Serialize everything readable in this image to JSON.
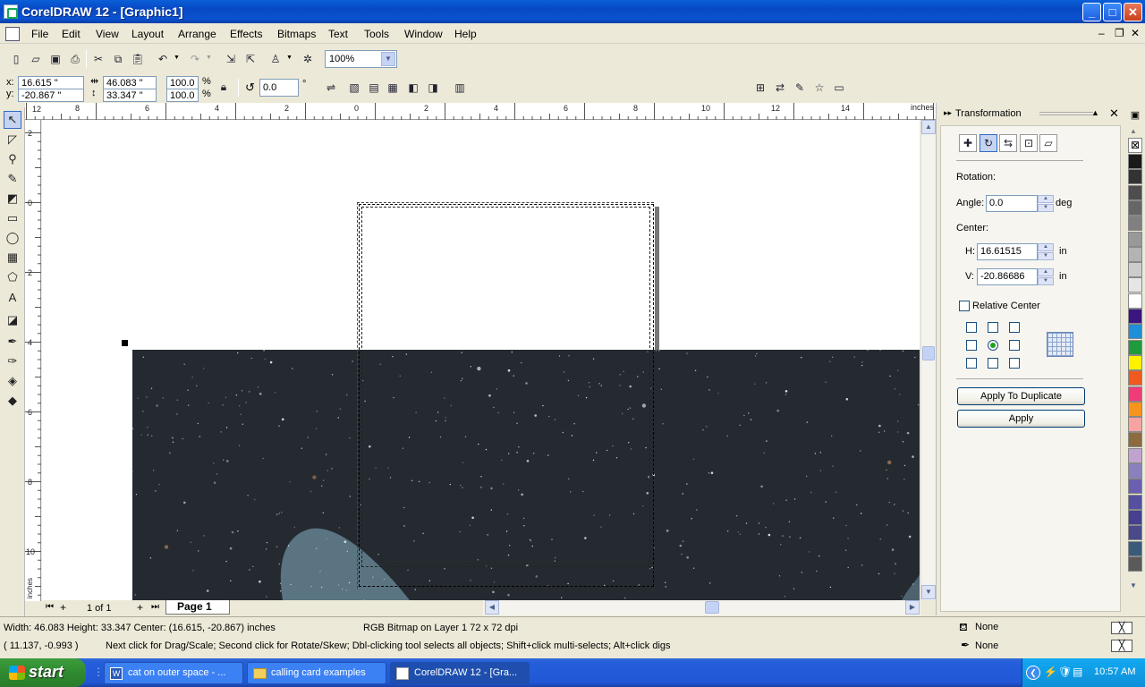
{
  "window": {
    "title": "CorelDRAW 12 - [Graphic1]"
  },
  "menu": [
    "File",
    "Edit",
    "View",
    "Layout",
    "Arrange",
    "Effects",
    "Bitmaps",
    "Text",
    "Tools",
    "Window",
    "Help"
  ],
  "toolbar": {
    "zoom": "100%"
  },
  "property_bar": {
    "x": "16.615 \"",
    "y": "-20.867 \"",
    "w": "46.083 \"",
    "h": "33.347 \"",
    "scale_x": "100.0",
    "scale_y": "100.0",
    "pct": "%",
    "rotation": "0.0",
    "deg": "°"
  },
  "ruler": {
    "h_labels": [
      "8",
      "6",
      "4",
      "2",
      "0",
      "2",
      "4",
      "6",
      "8",
      "10",
      "12",
      "14"
    ],
    "v_labels": [
      "2",
      "0",
      "2",
      "4",
      "6",
      "8",
      "10"
    ],
    "unit": "inches"
  },
  "page_nav": {
    "count": "1 of 1",
    "tab": "Page 1"
  },
  "docker": {
    "title": "Transformation",
    "rotation_label": "Rotation:",
    "angle_label": "Angle:",
    "angle_value": "0.0",
    "angle_unit": "deg",
    "center_label": "Center:",
    "h_label": "H:",
    "h_value": "16.61515",
    "h_unit": "in",
    "v_label": "V:",
    "v_value": "-20.86686",
    "v_unit": "in",
    "relative_center": "Relative Center",
    "apply_dup": "Apply To Duplicate",
    "apply": "Apply"
  },
  "palette": [
    "#1a1a1a",
    "#333333",
    "#4d4d4d",
    "#666666",
    "#808080",
    "#999999",
    "#b3b3b3",
    "#cccccc",
    "#e6e6e6",
    "#ffffff",
    "#3b1680",
    "#1e8fd8",
    "#1f9a3c",
    "#fff200",
    "#f05a1e",
    "#ef3c78",
    "#f7941d",
    "#f6a3a1",
    "#8c6b3f",
    "#c0a4cf",
    "#8a80c0",
    "#6a5fb0",
    "#5650a0",
    "#473f8f",
    "#4a4a8a",
    "#3a5a7a",
    "#5a5a5a"
  ],
  "status": {
    "dims": "Width: 46.083  Height: 33.347  Center: (16.615, -20.867)  inches",
    "object": "RGB Bitmap on Layer 1 72 x 72 dpi",
    "coords": "( 11.137, -0.993 )",
    "hint": "Next click for Drag/Scale; Second click for Rotate/Skew; Dbl-clicking tool selects all objects; Shift+click multi-selects; Alt+click digs",
    "fill": "None",
    "outline": "None"
  },
  "taskbar": {
    "start": "start",
    "tasks": [
      "cat on outer space - ...",
      "calling card examples",
      "CorelDRAW 12 - [Gra..."
    ],
    "clock": "10:57 AM"
  }
}
